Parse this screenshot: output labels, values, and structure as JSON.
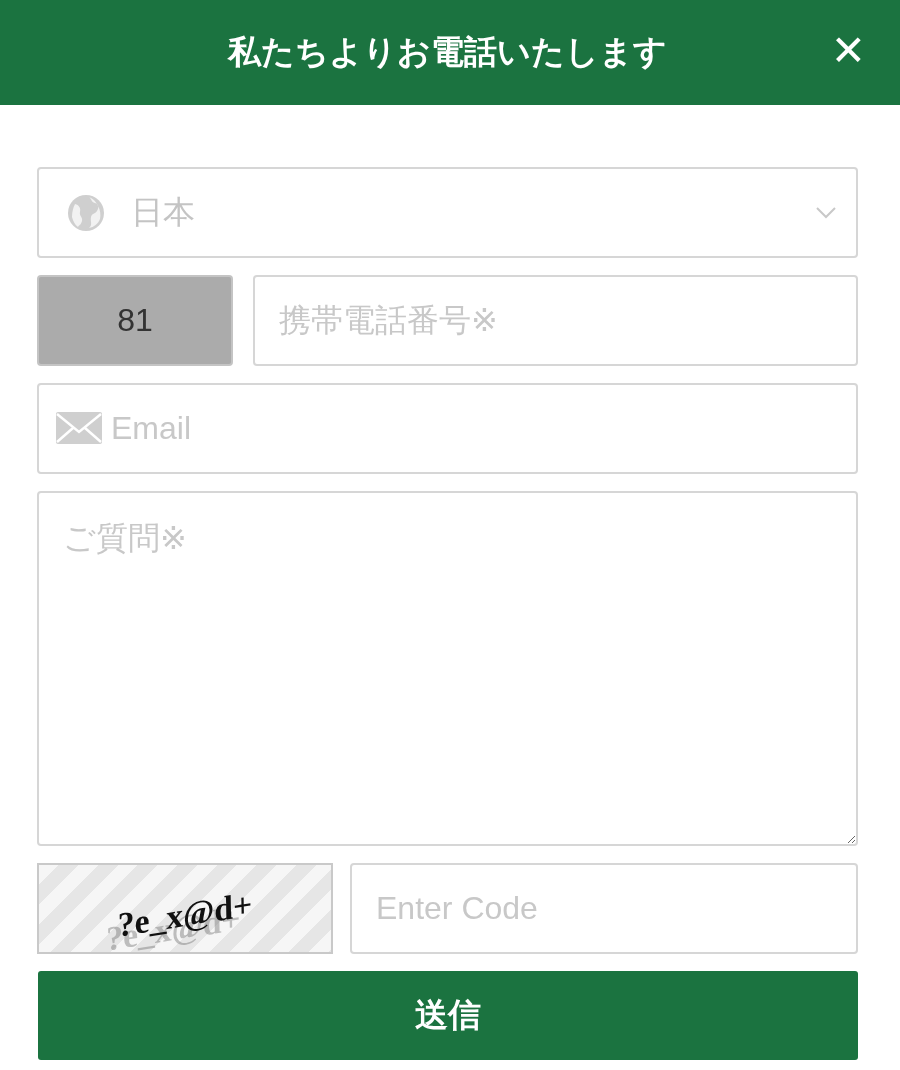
{
  "header": {
    "title": "私たちよりお電話いたします",
    "close": "✕"
  },
  "country_select": {
    "value": "日本"
  },
  "phone": {
    "country_code": "81",
    "code_disabled": true,
    "placeholder": "携帯電話番号※"
  },
  "email": {
    "placeholder": "Email"
  },
  "question": {
    "placeholder": "ご質問※"
  },
  "captcha": {
    "text": "?e_x@d+",
    "placeholder": "Enter Code"
  },
  "submit": {
    "label": "送信"
  }
}
